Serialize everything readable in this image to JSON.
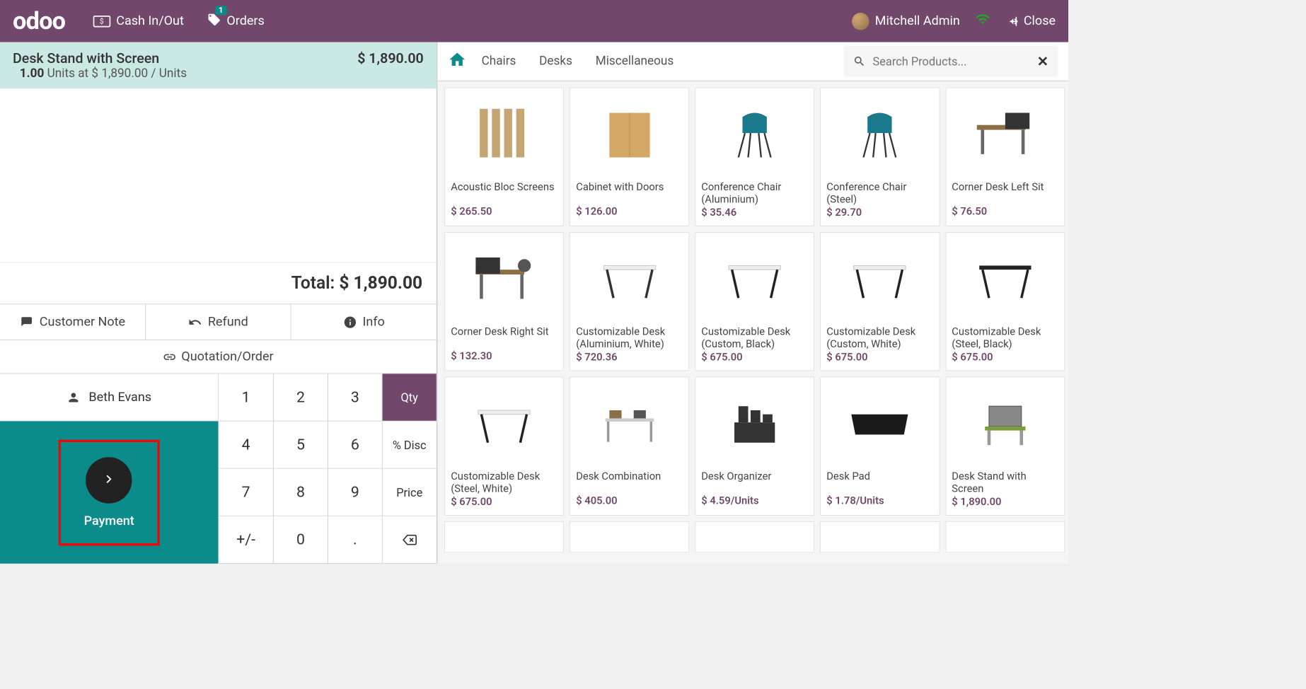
{
  "header": {
    "logo": "odoo",
    "cash": "Cash In/Out",
    "orders_badge": "1",
    "orders": "Orders",
    "user": "Mitchell Admin",
    "close": "Close"
  },
  "order_line": {
    "name": "Desk Stand with Screen",
    "line_price": "$ 1,890.00",
    "qty": "1.00",
    "unit": "Units at",
    "unit_price": "$ 1,890.00 / Units"
  },
  "totals": {
    "label": "Total:",
    "amount": "$ 1,890.00"
  },
  "actions": {
    "customer_note": "Customer Note",
    "refund": "Refund",
    "info": "Info",
    "quotation": "Quotation/Order",
    "customer": "Beth Evans",
    "payment": "Payment"
  },
  "numpad": {
    "k1": "1",
    "k2": "2",
    "k3": "3",
    "qty": "Qty",
    "k4": "4",
    "k5": "5",
    "k6": "6",
    "disc": "% Disc",
    "k7": "7",
    "k8": "8",
    "k9": "9",
    "price": "Price",
    "pm": "+/-",
    "k0": "0",
    "dot": "."
  },
  "categories": {
    "chairs": "Chairs",
    "desks": "Desks",
    "misc": "Miscellaneous"
  },
  "search": {
    "placeholder": "Search Products..."
  },
  "products": [
    {
      "name": "Acoustic Bloc Screens",
      "price": "$ 265.50"
    },
    {
      "name": "Cabinet with Doors",
      "price": "$ 126.00"
    },
    {
      "name": "Conference Chair (Aluminium)",
      "price": "$ 35.46"
    },
    {
      "name": "Conference Chair (Steel)",
      "price": "$ 29.70"
    },
    {
      "name": "Corner Desk Left Sit",
      "price": "$ 76.50"
    },
    {
      "name": "Corner Desk Right Sit",
      "price": "$ 132.30"
    },
    {
      "name": "Customizable Desk (Aluminium, White)",
      "price": "$ 720.36"
    },
    {
      "name": "Customizable Desk (Custom, Black)",
      "price": "$ 675.00"
    },
    {
      "name": "Customizable Desk (Custom, White)",
      "price": "$ 675.00"
    },
    {
      "name": "Customizable Desk (Steel, Black)",
      "price": "$ 675.00"
    },
    {
      "name": "Customizable Desk (Steel, White)",
      "price": "$ 675.00"
    },
    {
      "name": "Desk Combination",
      "price": "$ 405.00"
    },
    {
      "name": "Desk Organizer",
      "price": "$ 4.59/Units"
    },
    {
      "name": "Desk Pad",
      "price": "$ 1.78/Units"
    },
    {
      "name": "Desk Stand with Screen",
      "price": "$ 1,890.00"
    }
  ]
}
